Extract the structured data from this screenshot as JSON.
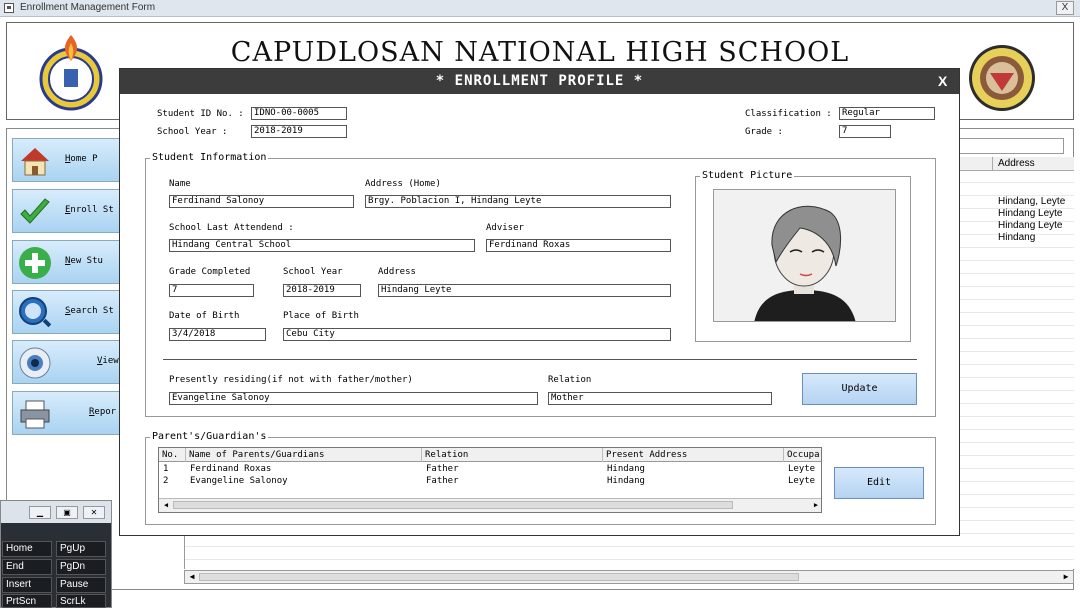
{
  "window": {
    "title": "Enrollment Management Form",
    "close_label": "X"
  },
  "header": {
    "school_name": "CAPUDLOSAN NATIONAL HIGH SCHOOL"
  },
  "nav": {
    "items": [
      {
        "label": "Home P",
        "icon": "house-icon"
      },
      {
        "label": "Enroll St",
        "icon": "checkmark-icon"
      },
      {
        "label": "New Stu",
        "icon": "plus-icon"
      },
      {
        "label": "Search St",
        "icon": "magnifier-icon"
      },
      {
        "label": "View",
        "icon": "eye-icon"
      },
      {
        "label": "Repor",
        "icon": "printer-icon"
      }
    ]
  },
  "background_grid": {
    "column_header": "Address",
    "values": [
      "Hindang, Leyte",
      "Hindang Leyte",
      "Hindang Leyte",
      "Hindang"
    ]
  },
  "keyboard": {
    "keys": [
      [
        "Home",
        "PgUp"
      ],
      [
        "End",
        "PgDn"
      ],
      [
        "Insert",
        "Pause"
      ],
      [
        "PrtScn",
        "ScrLk"
      ]
    ]
  },
  "dialog": {
    "title": "* ENROLLMENT PROFILE *",
    "close_label": "X",
    "student_id_label": "Student ID No. :",
    "student_id": "IDNO-00-0005",
    "school_year_label": "School Year :",
    "school_year": "2018-2019",
    "classification_label": "Classification :",
    "classification": "Regular",
    "grade_label": "Grade :",
    "grade": "7",
    "student_info": {
      "legend": "Student Information",
      "name_label": "Name",
      "name": "Ferdinand Salonoy",
      "address_home_label": "Address (Home)",
      "address_home": "Brgy. Poblacion I, Hindang Leyte",
      "last_school_label": "School Last Attendend :",
      "last_school": "Hindang Central School",
      "adviser_label": "Adviser",
      "adviser": "Ferdinand Roxas",
      "grade_completed_label": "Grade Completed",
      "grade_completed": "7",
      "prev_school_year_label": "School Year",
      "prev_school_year": "2018-2019",
      "school_address_label": "Address",
      "school_address": "Hindang Leyte",
      "dob_label": "Date of Birth",
      "dob": "3/4/2018",
      "pob_label": "Place of Birth",
      "pob": "Cebu City",
      "picture_legend": "Student Picture",
      "residing_label": "Presently residing(if not with father/mother)",
      "residing": "Evangeline Salonoy",
      "relation_label": "Relation",
      "relation": "Mother",
      "update_label": "Update"
    },
    "parents": {
      "legend": "Parent's/Guardian's",
      "columns": [
        "No.",
        "Name of Parents/Guardians",
        "Relation",
        "Present Address",
        "Occupa"
      ],
      "rows": [
        [
          "1",
          "Ferdinand Roxas",
          "Father",
          "Hindang",
          "Leyte"
        ],
        [
          "2",
          "Evangeline Salonoy",
          "Father",
          "Hindang",
          "Leyte"
        ]
      ],
      "edit_label": "Edit"
    }
  }
}
